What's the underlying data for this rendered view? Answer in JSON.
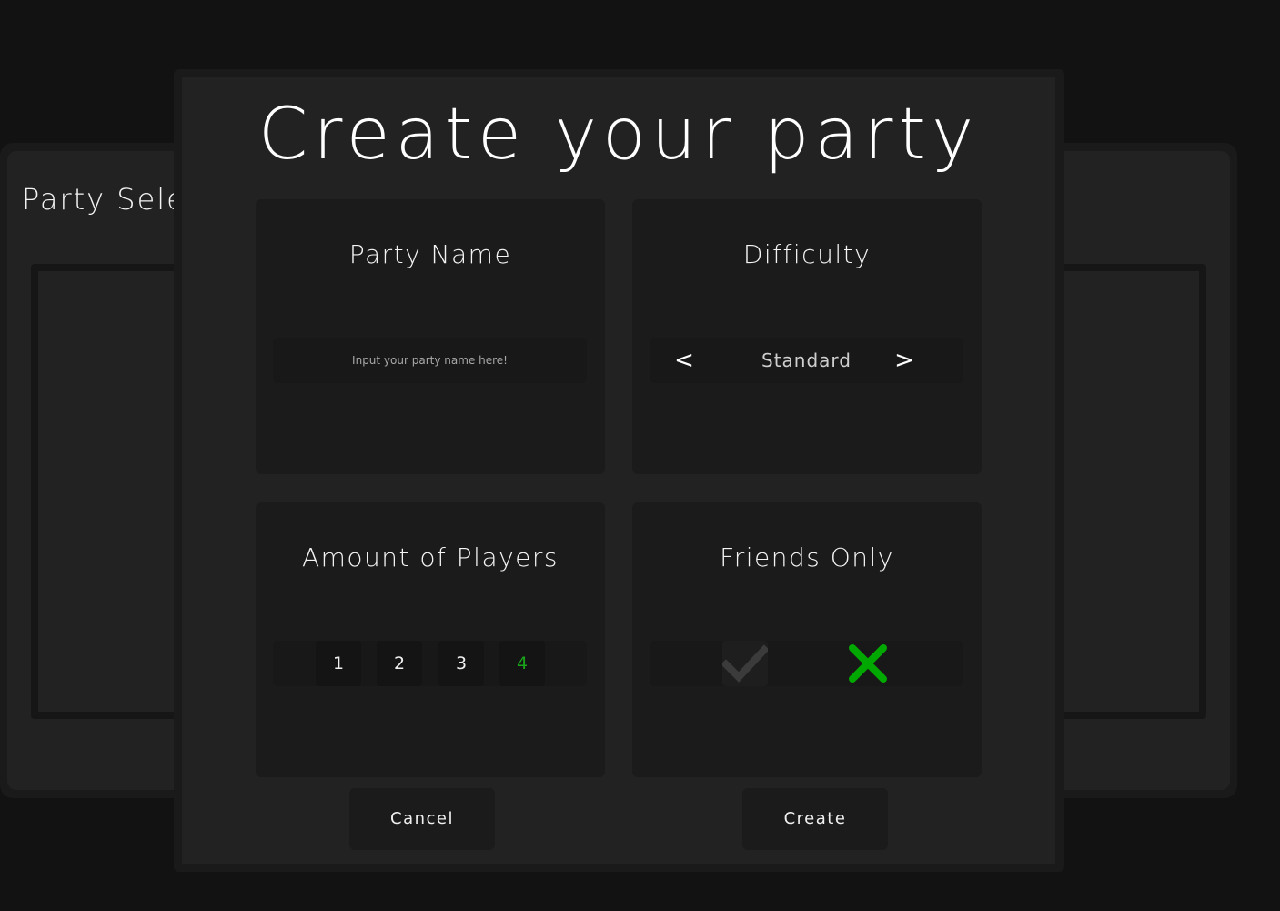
{
  "background": {
    "title": "Party Sele"
  },
  "modal": {
    "title": "Create your party",
    "party_name": {
      "label": "Party Name",
      "placeholder": "Input your party name here!"
    },
    "difficulty": {
      "label": "Difficulty",
      "prev": "<",
      "value": "Standard",
      "next": ">"
    },
    "players": {
      "label": "Amount of Players",
      "options": [
        "1",
        "2",
        "3",
        "4"
      ],
      "selected": "4"
    },
    "friends_only": {
      "label": "Friends Only",
      "yes_icon": "check-icon",
      "no_icon": "x-icon",
      "selected": "no"
    },
    "buttons": {
      "cancel": "Cancel",
      "create": "Create"
    }
  },
  "colors": {
    "accent_green": "#1aa31a",
    "toggle_green": "#00a800",
    "inactive_check": "#3b3b3b"
  }
}
